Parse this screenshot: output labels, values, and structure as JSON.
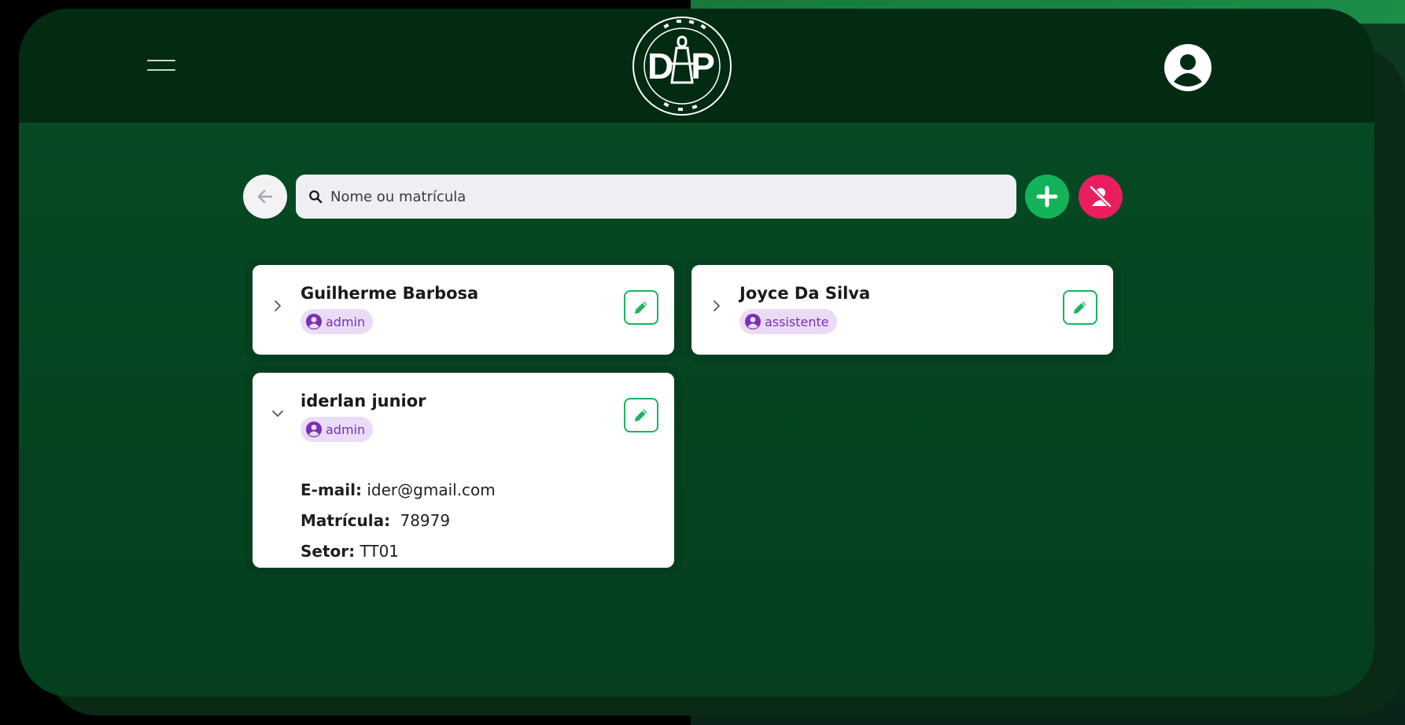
{
  "header": {
    "menu_icon": "hamburger-icon",
    "logo_text": "DP",
    "profile_icon": "user-circle-icon"
  },
  "toolbar": {
    "back_icon": "arrow-left-icon",
    "search_icon": "search-icon",
    "search_placeholder": "Nome ou matrícula",
    "search_value": "",
    "add_icon": "plus-icon",
    "remove_icon": "user-remove-icon"
  },
  "users": [
    {
      "name": "Guilherme Barbosa",
      "role": "admin",
      "expanded": false
    },
    {
      "name": "Joyce Da Silva",
      "role": "assistente",
      "expanded": false
    },
    {
      "name": "iderlan junior",
      "role": "admin",
      "expanded": true,
      "email_label": "E-mail:",
      "email": "ider@gmail.com",
      "matricula_label": "Matrícula:",
      "matricula": "78979",
      "setor_label": "Setor:",
      "setor": "TT01"
    }
  ],
  "colors": {
    "header_bg": "#022b12",
    "app_bg": "#064b24",
    "accent_green": "#13b35a",
    "danger_pink": "#ea1d5e",
    "badge_bg": "#eadcf6",
    "badge_text": "#7b2fb5"
  }
}
